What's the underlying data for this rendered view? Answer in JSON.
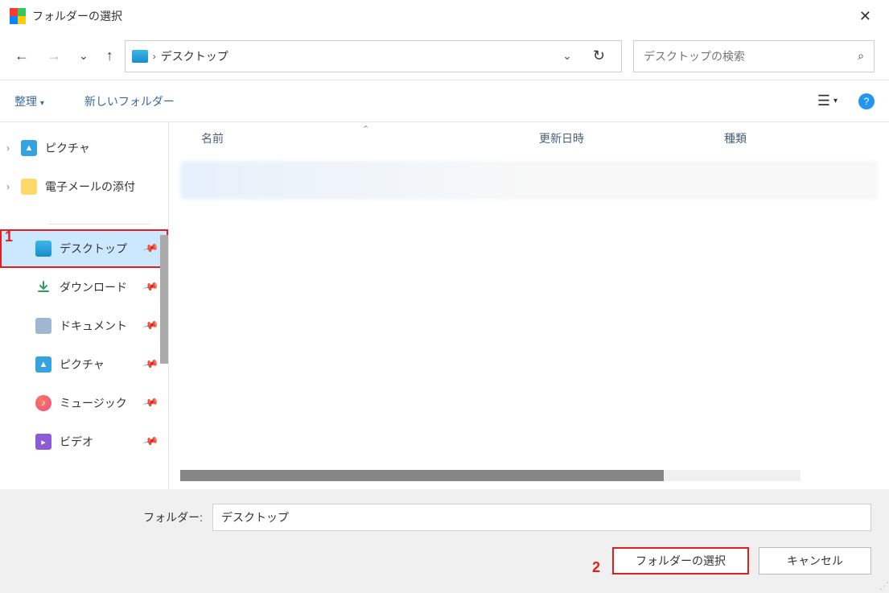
{
  "titlebar": {
    "title": "フォルダーの選択"
  },
  "path": {
    "location": "デスクトップ"
  },
  "search": {
    "placeholder": "デスクトップの検索"
  },
  "toolbar": {
    "organize": "整理",
    "new_folder": "新しいフォルダー"
  },
  "columns": {
    "name": "名前",
    "date": "更新日時",
    "type": "種類"
  },
  "tree": {
    "topA": "ピクチャ",
    "topB": "電子メールの添付",
    "pinned": [
      {
        "label": "デスクトップ",
        "selected": true,
        "highlight": true,
        "icon": "desktop"
      },
      {
        "label": "ダウンロード",
        "icon": "download"
      },
      {
        "label": "ドキュメント",
        "icon": "document"
      },
      {
        "label": "ピクチャ",
        "icon": "pictures"
      },
      {
        "label": "ミュージック",
        "icon": "music"
      },
      {
        "label": "ビデオ",
        "icon": "video"
      }
    ]
  },
  "bottom": {
    "folder_label": "フォルダー:",
    "folder_value": "デスクトップ",
    "select": "フォルダーの選択",
    "cancel": "キャンセル"
  },
  "annotations": {
    "a1": "1",
    "a2": "2"
  }
}
